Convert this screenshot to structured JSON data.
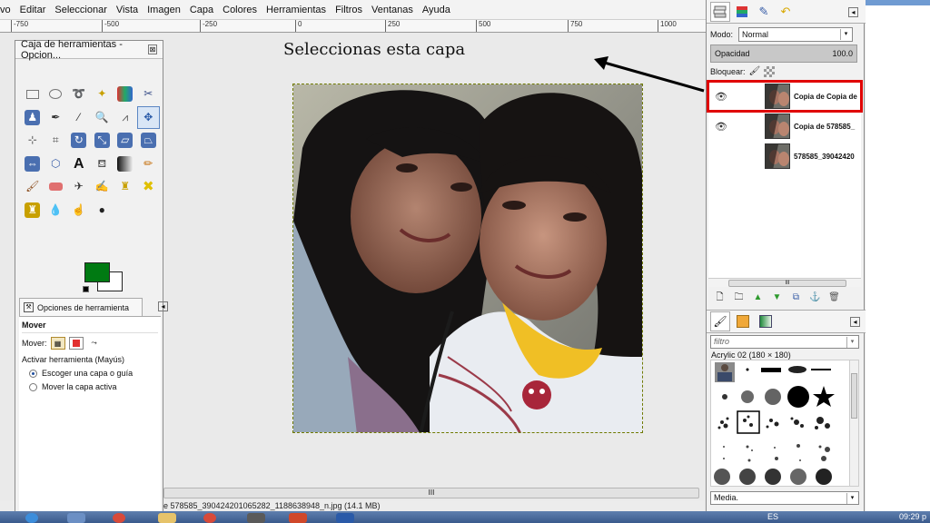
{
  "menubar": {
    "items": [
      "vo",
      "Editar",
      "Seleccionar",
      "Vista",
      "Imagen",
      "Capa",
      "Colores",
      "Herramientas",
      "Filtros",
      "Ventanas",
      "Ayuda"
    ]
  },
  "ruler": {
    "labels": [
      "-750",
      "-500",
      "-250",
      "0",
      "250",
      "500",
      "750",
      "1000"
    ]
  },
  "toolbox": {
    "title": "Caja de herramientas - Opcion...",
    "fg_color": "#007a12",
    "bg_color": "#ffffff",
    "options_tab": "Opciones de herramienta",
    "tool_name": "Mover",
    "mover_label": "Mover:",
    "activate_label": "Activar herramienta  (Mayús)",
    "radio_options": [
      "Escoger una capa o guía",
      "Mover la capa activa"
    ],
    "selected_radio": 0
  },
  "annotation": {
    "text": "Seleccionas esta capa"
  },
  "statusbar": {
    "text": "e 578585_390424201065282_1188638948_n.jpg (14.1 MB)",
    "scroll_grip": "III"
  },
  "layers_panel": {
    "mode_label": "Modo:",
    "mode_value": "Normal",
    "opacity_label": "Opacidad",
    "opacity_value": "100.0",
    "lock_label": "Bloquear:",
    "layers": [
      {
        "name": "Copia de Copia de",
        "visible": true,
        "selected": true
      },
      {
        "name": "Copia de 578585_",
        "visible": true,
        "selected": false
      },
      {
        "name": "578585_39042420",
        "visible": false,
        "selected": false
      }
    ],
    "scroll_grip": "III"
  },
  "brushes_panel": {
    "filter_placeholder": "filtro",
    "brush_name": "Acrylic 02 (180 × 180)",
    "spacing_label": "Media."
  },
  "taskbar": {
    "clock": "09:29 p",
    "tray_text": "ES"
  },
  "colors": {
    "selection_outline": "#e00000",
    "accent_blue": "#1f4fa0"
  }
}
